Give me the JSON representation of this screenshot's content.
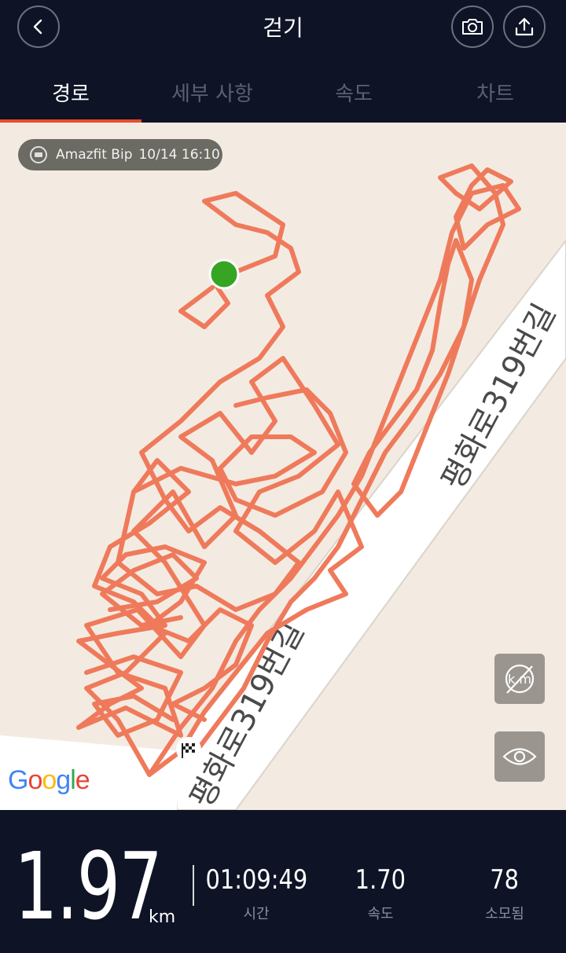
{
  "header": {
    "title": "걷기",
    "back_icon": "chevron-left-icon",
    "camera_icon": "camera-icon",
    "share_icon": "share-icon"
  },
  "tabs": [
    {
      "label": "경로",
      "active": true
    },
    {
      "label": "세부 사항",
      "active": false
    },
    {
      "label": "속도",
      "active": false
    },
    {
      "label": "차트",
      "active": false
    }
  ],
  "map": {
    "device": "Amazfit Bip",
    "datetime": "10/14 16:10",
    "road_label_upper": "평화로319번길",
    "road_label_lower": "평화로319번길",
    "google": "Google",
    "route_color": "#ef7a5b",
    "start_color": "#35a523",
    "buttons": {
      "km_icon": "km-toggle-icon",
      "eye_icon": "eye-icon",
      "finish_icon": "checkered-flag-icon"
    }
  },
  "stats": {
    "distance": "1.97",
    "distance_unit": "km",
    "time_value": "01:09:49",
    "time_label": "시간",
    "speed_value": "1.70",
    "speed_label": "속도",
    "calories_value": "78",
    "calories_label": "소모됨"
  },
  "colors": {
    "background": "#0e1426",
    "accent": "#e84c2f",
    "tab_inactive": "#5a6070"
  }
}
